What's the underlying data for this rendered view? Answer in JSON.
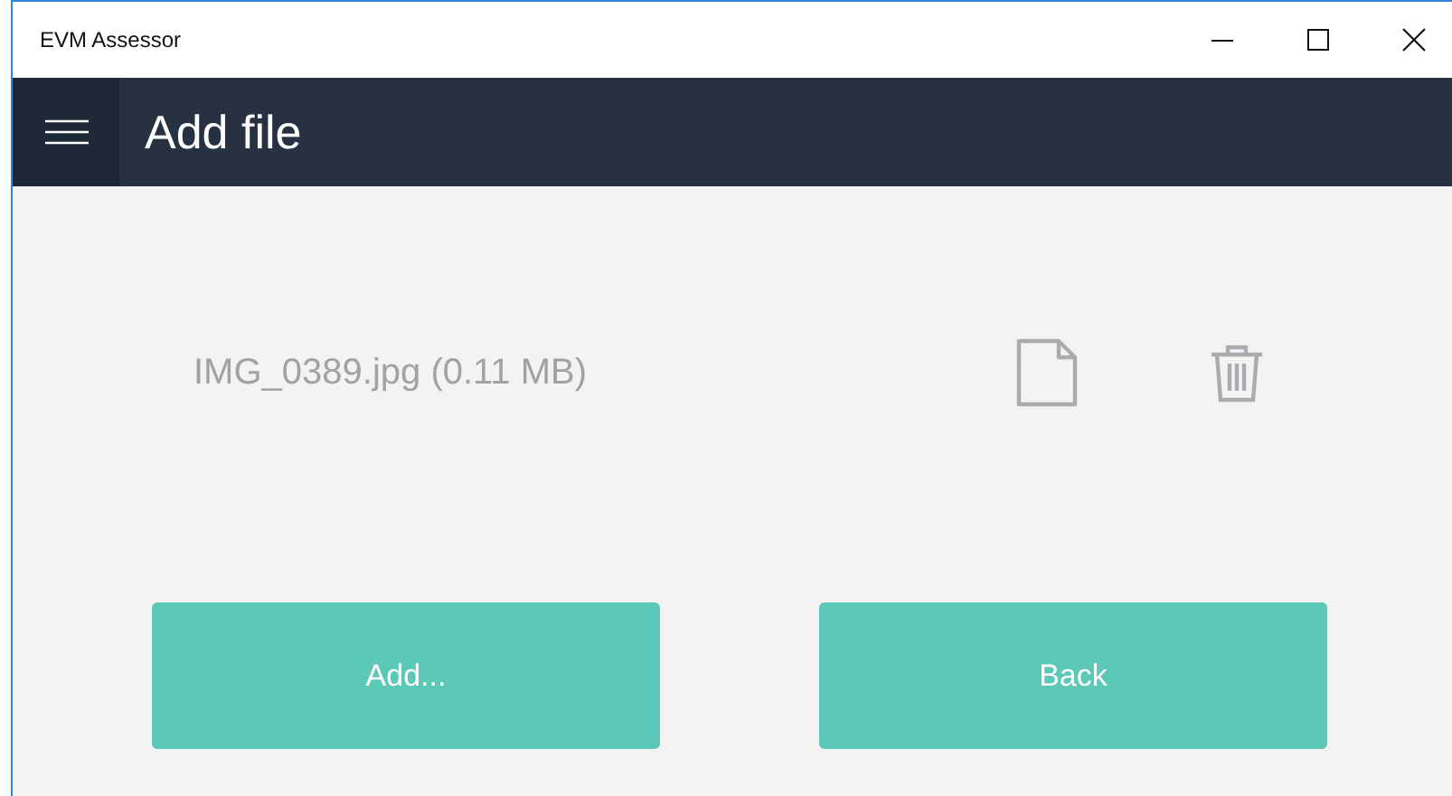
{
  "window": {
    "title": "EVM Assessor"
  },
  "header": {
    "title": "Add file"
  },
  "files": [
    {
      "name": "IMG_0389.jpg (0.11 MB)"
    }
  ],
  "buttons": [
    "Add...",
    "Back"
  ]
}
